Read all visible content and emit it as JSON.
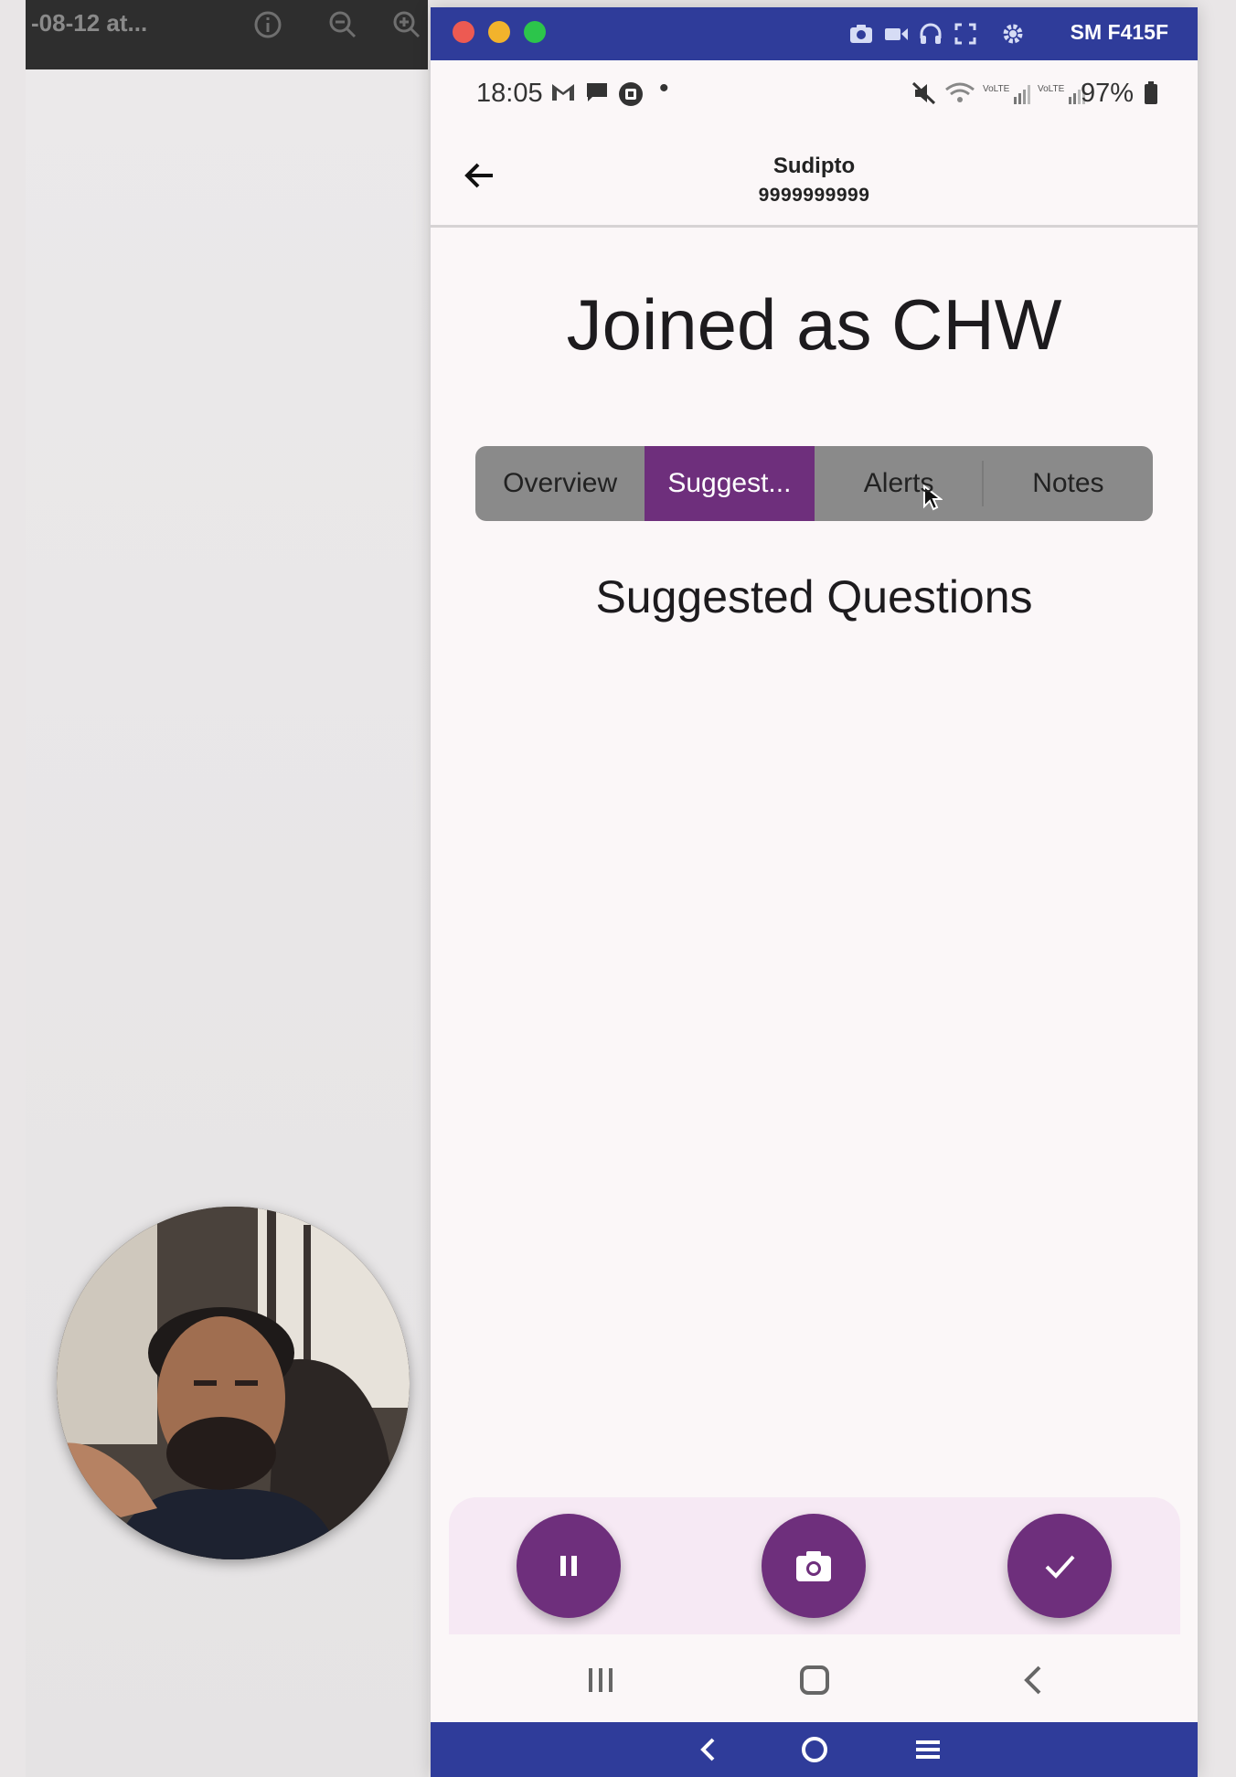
{
  "host": {
    "title_fragment": "-08-12 at...",
    "icons": [
      "info-icon",
      "zoom-out-icon",
      "zoom-in-icon"
    ]
  },
  "mirror": {
    "device_name": "SM F415F",
    "titlebar_icons": [
      "screenshot-icon",
      "record-icon",
      "headphones-icon",
      "fullscreen-icon",
      "settings-icon"
    ],
    "titlebar_color": "#2f3c9a",
    "bottom_controls": [
      "back-icon",
      "home-icon",
      "menu-icon"
    ]
  },
  "status_bar": {
    "time": "18:05",
    "battery": "97%",
    "left_icons": [
      "gmail-icon",
      "message-icon",
      "app-icon"
    ],
    "right_icons": [
      "mute-icon",
      "wifi-icon",
      "volte-signal-icon",
      "volte-signal-icon-2",
      "battery-icon"
    ]
  },
  "app_bar": {
    "name": "Sudipto",
    "phone": "9999999999"
  },
  "main": {
    "heading": "Joined as CHW",
    "tabs": [
      {
        "label": "Overview",
        "active": false
      },
      {
        "label": "Suggest...",
        "active": true
      },
      {
        "label": "Alerts",
        "active": false
      },
      {
        "label": "Notes",
        "active": false
      }
    ],
    "section_title": "Suggested Questions"
  },
  "actions": {
    "buttons": [
      "pause-icon",
      "camera-icon",
      "check-icon"
    ],
    "accent": "#6e2f7c"
  },
  "nav_bar": {
    "buttons": [
      "recents-icon",
      "home-icon",
      "back-icon"
    ]
  }
}
